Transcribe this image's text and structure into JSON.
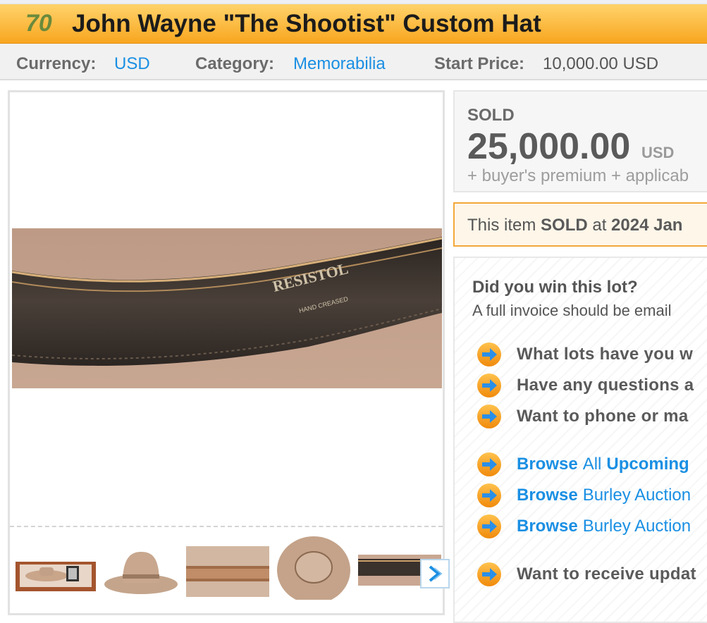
{
  "lot": {
    "number": "70",
    "title": "John Wayne \"The Shootist\" Custom Hat"
  },
  "info": {
    "currency_label": "Currency:",
    "currency_value": "USD",
    "category_label": "Category:",
    "category_value": "Memorabilia",
    "start_label": "Start Price:",
    "start_value": "10,000.00 USD"
  },
  "gallery": {
    "main_image_text": [
      "RESISTOL",
      "HAND CREASED"
    ],
    "thumbnails": [
      "thumb-hat-display-case",
      "thumb-hat-side",
      "thumb-hat-band-front",
      "thumb-hat-top",
      "thumb-hat-inner-band"
    ],
    "next_icon": "chevron-right-icon"
  },
  "sold": {
    "label": "SOLD",
    "price": "25,000.00",
    "currency": "USD",
    "premium": "+ buyer's premium + applicab"
  },
  "notice": {
    "prefix": "This item ",
    "sold_word": "SOLD",
    "mid": " at ",
    "date": "2024 Jan"
  },
  "win": {
    "title": "Did you win this lot?",
    "subtitle": "A full invoice should be email",
    "questions": [
      "What lots have you w",
      "Have any questions a",
      "Want to phone or ma"
    ],
    "browse": [
      {
        "strong": "Browse",
        "plain": "All",
        "strong2": "Upcoming"
      },
      {
        "strong": "Browse",
        "plain": "Burley Auction"
      },
      {
        "strong": "Browse",
        "plain": "Burley Auction"
      }
    ],
    "updates": "Want to receive updat"
  },
  "colors": {
    "title_bar": "#f8a61f",
    "link": "#1a8fe3",
    "notice_border": "#f4a83a",
    "lot_number": "#6a8a3c"
  }
}
